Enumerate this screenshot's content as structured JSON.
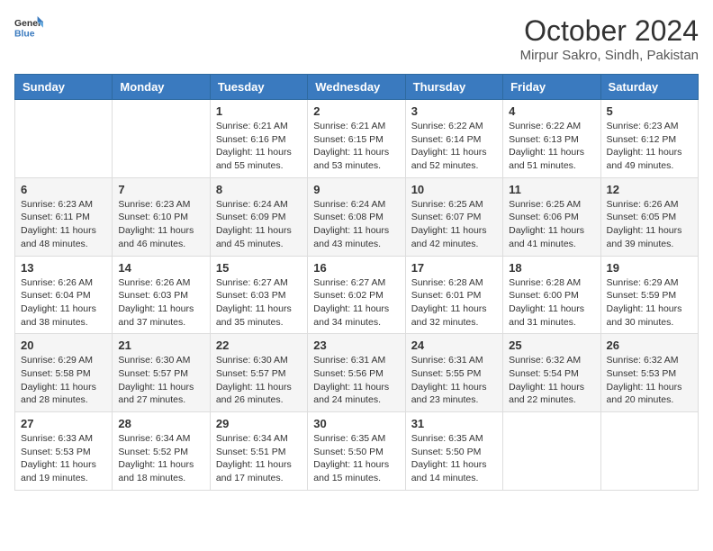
{
  "header": {
    "logo": {
      "general": "General",
      "blue": "Blue"
    },
    "month": "October 2024",
    "location": "Mirpur Sakro, Sindh, Pakistan"
  },
  "weekdays": [
    "Sunday",
    "Monday",
    "Tuesday",
    "Wednesday",
    "Thursday",
    "Friday",
    "Saturday"
  ],
  "weeks": [
    [
      {
        "day": "",
        "sunrise": "",
        "sunset": "",
        "daylight": ""
      },
      {
        "day": "",
        "sunrise": "",
        "sunset": "",
        "daylight": ""
      },
      {
        "day": "1",
        "sunrise": "Sunrise: 6:21 AM",
        "sunset": "Sunset: 6:16 PM",
        "daylight": "Daylight: 11 hours and 55 minutes."
      },
      {
        "day": "2",
        "sunrise": "Sunrise: 6:21 AM",
        "sunset": "Sunset: 6:15 PM",
        "daylight": "Daylight: 11 hours and 53 minutes."
      },
      {
        "day": "3",
        "sunrise": "Sunrise: 6:22 AM",
        "sunset": "Sunset: 6:14 PM",
        "daylight": "Daylight: 11 hours and 52 minutes."
      },
      {
        "day": "4",
        "sunrise": "Sunrise: 6:22 AM",
        "sunset": "Sunset: 6:13 PM",
        "daylight": "Daylight: 11 hours and 51 minutes."
      },
      {
        "day": "5",
        "sunrise": "Sunrise: 6:23 AM",
        "sunset": "Sunset: 6:12 PM",
        "daylight": "Daylight: 11 hours and 49 minutes."
      }
    ],
    [
      {
        "day": "6",
        "sunrise": "Sunrise: 6:23 AM",
        "sunset": "Sunset: 6:11 PM",
        "daylight": "Daylight: 11 hours and 48 minutes."
      },
      {
        "day": "7",
        "sunrise": "Sunrise: 6:23 AM",
        "sunset": "Sunset: 6:10 PM",
        "daylight": "Daylight: 11 hours and 46 minutes."
      },
      {
        "day": "8",
        "sunrise": "Sunrise: 6:24 AM",
        "sunset": "Sunset: 6:09 PM",
        "daylight": "Daylight: 11 hours and 45 minutes."
      },
      {
        "day": "9",
        "sunrise": "Sunrise: 6:24 AM",
        "sunset": "Sunset: 6:08 PM",
        "daylight": "Daylight: 11 hours and 43 minutes."
      },
      {
        "day": "10",
        "sunrise": "Sunrise: 6:25 AM",
        "sunset": "Sunset: 6:07 PM",
        "daylight": "Daylight: 11 hours and 42 minutes."
      },
      {
        "day": "11",
        "sunrise": "Sunrise: 6:25 AM",
        "sunset": "Sunset: 6:06 PM",
        "daylight": "Daylight: 11 hours and 41 minutes."
      },
      {
        "day": "12",
        "sunrise": "Sunrise: 6:26 AM",
        "sunset": "Sunset: 6:05 PM",
        "daylight": "Daylight: 11 hours and 39 minutes."
      }
    ],
    [
      {
        "day": "13",
        "sunrise": "Sunrise: 6:26 AM",
        "sunset": "Sunset: 6:04 PM",
        "daylight": "Daylight: 11 hours and 38 minutes."
      },
      {
        "day": "14",
        "sunrise": "Sunrise: 6:26 AM",
        "sunset": "Sunset: 6:03 PM",
        "daylight": "Daylight: 11 hours and 37 minutes."
      },
      {
        "day": "15",
        "sunrise": "Sunrise: 6:27 AM",
        "sunset": "Sunset: 6:03 PM",
        "daylight": "Daylight: 11 hours and 35 minutes."
      },
      {
        "day": "16",
        "sunrise": "Sunrise: 6:27 AM",
        "sunset": "Sunset: 6:02 PM",
        "daylight": "Daylight: 11 hours and 34 minutes."
      },
      {
        "day": "17",
        "sunrise": "Sunrise: 6:28 AM",
        "sunset": "Sunset: 6:01 PM",
        "daylight": "Daylight: 11 hours and 32 minutes."
      },
      {
        "day": "18",
        "sunrise": "Sunrise: 6:28 AM",
        "sunset": "Sunset: 6:00 PM",
        "daylight": "Daylight: 11 hours and 31 minutes."
      },
      {
        "day": "19",
        "sunrise": "Sunrise: 6:29 AM",
        "sunset": "Sunset: 5:59 PM",
        "daylight": "Daylight: 11 hours and 30 minutes."
      }
    ],
    [
      {
        "day": "20",
        "sunrise": "Sunrise: 6:29 AM",
        "sunset": "Sunset: 5:58 PM",
        "daylight": "Daylight: 11 hours and 28 minutes."
      },
      {
        "day": "21",
        "sunrise": "Sunrise: 6:30 AM",
        "sunset": "Sunset: 5:57 PM",
        "daylight": "Daylight: 11 hours and 27 minutes."
      },
      {
        "day": "22",
        "sunrise": "Sunrise: 6:30 AM",
        "sunset": "Sunset: 5:57 PM",
        "daylight": "Daylight: 11 hours and 26 minutes."
      },
      {
        "day": "23",
        "sunrise": "Sunrise: 6:31 AM",
        "sunset": "Sunset: 5:56 PM",
        "daylight": "Daylight: 11 hours and 24 minutes."
      },
      {
        "day": "24",
        "sunrise": "Sunrise: 6:31 AM",
        "sunset": "Sunset: 5:55 PM",
        "daylight": "Daylight: 11 hours and 23 minutes."
      },
      {
        "day": "25",
        "sunrise": "Sunrise: 6:32 AM",
        "sunset": "Sunset: 5:54 PM",
        "daylight": "Daylight: 11 hours and 22 minutes."
      },
      {
        "day": "26",
        "sunrise": "Sunrise: 6:32 AM",
        "sunset": "Sunset: 5:53 PM",
        "daylight": "Daylight: 11 hours and 20 minutes."
      }
    ],
    [
      {
        "day": "27",
        "sunrise": "Sunrise: 6:33 AM",
        "sunset": "Sunset: 5:53 PM",
        "daylight": "Daylight: 11 hours and 19 minutes."
      },
      {
        "day": "28",
        "sunrise": "Sunrise: 6:34 AM",
        "sunset": "Sunset: 5:52 PM",
        "daylight": "Daylight: 11 hours and 18 minutes."
      },
      {
        "day": "29",
        "sunrise": "Sunrise: 6:34 AM",
        "sunset": "Sunset: 5:51 PM",
        "daylight": "Daylight: 11 hours and 17 minutes."
      },
      {
        "day": "30",
        "sunrise": "Sunrise: 6:35 AM",
        "sunset": "Sunset: 5:50 PM",
        "daylight": "Daylight: 11 hours and 15 minutes."
      },
      {
        "day": "31",
        "sunrise": "Sunrise: 6:35 AM",
        "sunset": "Sunset: 5:50 PM",
        "daylight": "Daylight: 11 hours and 14 minutes."
      },
      {
        "day": "",
        "sunrise": "",
        "sunset": "",
        "daylight": ""
      },
      {
        "day": "",
        "sunrise": "",
        "sunset": "",
        "daylight": ""
      }
    ]
  ]
}
